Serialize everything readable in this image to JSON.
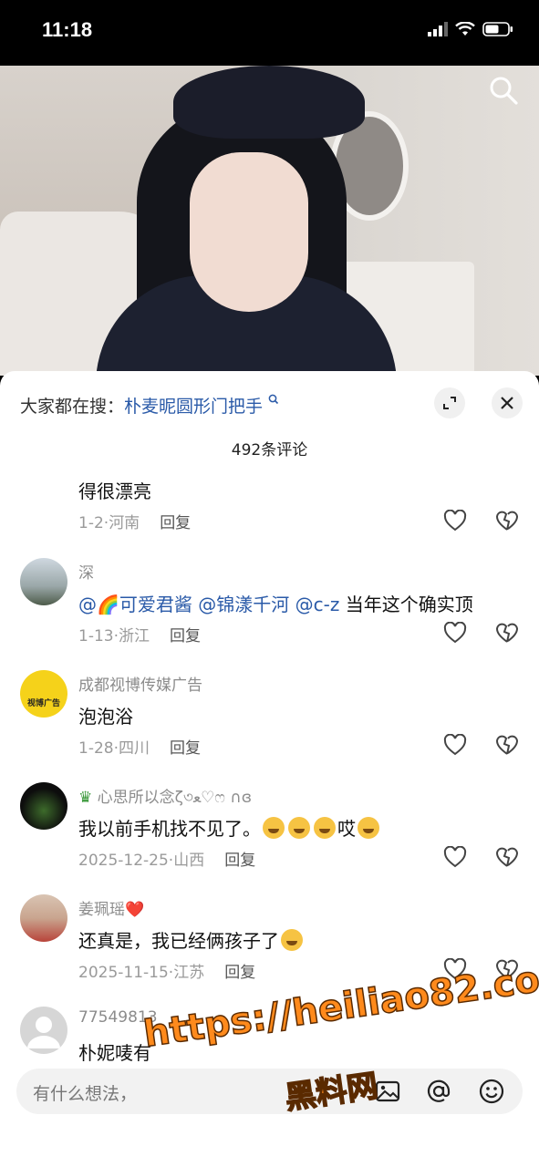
{
  "status_bar": {
    "time": "11:18"
  },
  "header": {
    "trend_label": "大家都在搜：",
    "trend_query": "朴麦昵圆形门把手",
    "comment_count": "492条评论"
  },
  "comments": [
    {
      "user": "",
      "text": "得很漂亮",
      "date": "1-2",
      "location": "河南",
      "reply": "回复"
    },
    {
      "user": "深",
      "mentions": [
        "@🌈可爱君酱",
        "@锦漾千河",
        "@c-z"
      ],
      "text": "当年这个确实顶",
      "date": "1-13",
      "location": "浙江",
      "reply": "回复"
    },
    {
      "user": "成都视博传媒广告",
      "avatar_text": "视博广告",
      "text": "泡泡浴",
      "date": "1-28",
      "location": "四川",
      "reply": "回复"
    },
    {
      "user": "心思所以念ζ৩ﻌ♡ෆ ∩ɞ",
      "text": "我以前手机找不见了。",
      "text_tail": "哎",
      "date": "2025-12-25",
      "location": "山西",
      "reply": "回复"
    },
    {
      "user": "姜珮瑶",
      "user_suffix": "❤️",
      "text": "还真是，我已经俩孩子了",
      "date": "2025-11-15",
      "location": "江苏",
      "reply": "回复"
    },
    {
      "user": "77549813",
      "text": "朴妮唛有"
    }
  ],
  "input": {
    "placeholder": "有什么想法，"
  },
  "watermark": {
    "url": "https://heiliao82.com",
    "name": "黑料网"
  },
  "colors": {
    "mention": "#2a5aa8",
    "watermark": "#ff8a1c",
    "sheet_bg": "#ffffff"
  }
}
